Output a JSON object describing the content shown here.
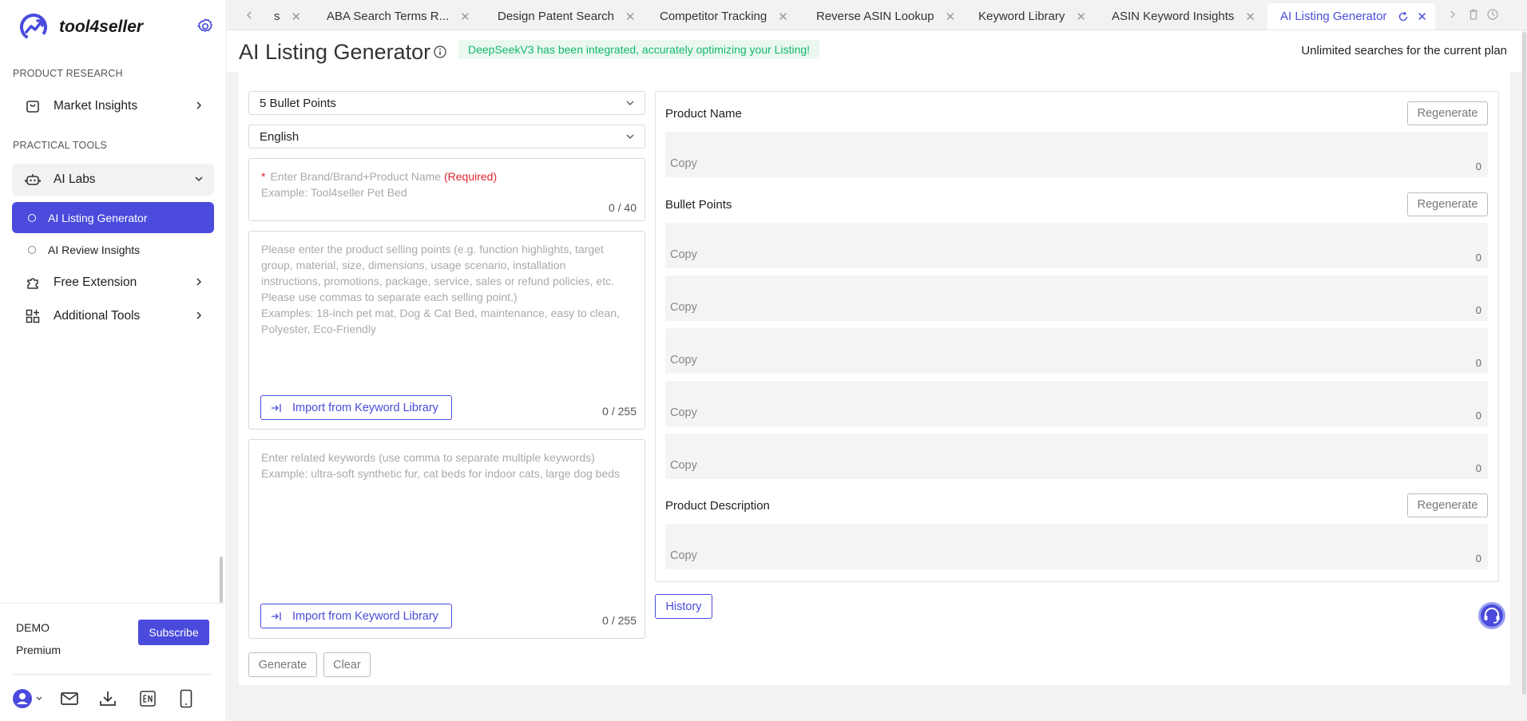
{
  "brand": {
    "name": "tool4seller"
  },
  "sidebar": {
    "section_product_research": "PRODUCT RESEARCH",
    "market_insights": "Market Insights",
    "section_practical_tools": "PRACTICAL TOOLS",
    "ai_labs": "AI Labs",
    "ai_listing_generator": "AI Listing Generator",
    "ai_review_insights": "AI Review Insights",
    "free_extension": "Free Extension",
    "additional_tools": "Additional Tools"
  },
  "user": {
    "name": "DEMO",
    "plan": "Premium",
    "subscribe_label": "Subscribe"
  },
  "tabs": [
    {
      "label": "s"
    },
    {
      "label": "ABA Search Terms R..."
    },
    {
      "label": "Design Patent Search"
    },
    {
      "label": "Competitor Tracking"
    },
    {
      "label": "Reverse ASIN Lookup"
    },
    {
      "label": "Keyword Library"
    },
    {
      "label": "ASIN Keyword Insights"
    },
    {
      "label": "AI Listing Generator"
    }
  ],
  "page": {
    "title": "AI Listing Generator",
    "notice": "DeepSeekV3 has been integrated, accurately optimizing your Listing!",
    "quota": "Unlimited searches for the current plan"
  },
  "form": {
    "bullet_select": "5 Bullet Points",
    "language_select": "English",
    "brand_placeholder": "Enter Brand/Brand+Product Name",
    "brand_required": "(Required)",
    "brand_example": "Example: Tool4seller Pet Bed",
    "brand_counter": "0 / 40",
    "selling_points_placeholder": "Please enter the product selling points (e.g. function highlights, target group, material, size, dimensions, usage scenario, installation instructions, promotions, package, service, sales or refund policies, etc. Please use commas to separate each selling point.)",
    "selling_points_example": "Examples: 18-inch pet mat, Dog & Cat Bed, maintenance, easy to clean, Polyester, Eco-Friendly",
    "selling_points_counter": "0 / 255",
    "keywords_placeholder": "Enter related keywords (use comma to separate multiple keywords)",
    "keywords_example": "Example: ultra-soft synthetic fur, cat beds for indoor cats, large dog beds",
    "keywords_counter": "0 / 255",
    "import_label": "Import from Keyword Library",
    "generate_label": "Generate",
    "clear_label": "Clear"
  },
  "results": {
    "product_name_label": "Product Name",
    "bullet_points_label": "Bullet Points",
    "product_description_label": "Product Description",
    "regenerate_label": "Regenerate",
    "copy_label": "Copy",
    "count": "0",
    "history_label": "History"
  },
  "icons": {
    "logo": "trend-chart-logo-icon",
    "gear": "gear-icon",
    "market": "shopping-bag-icon",
    "ai_labs": "robot-icon",
    "extension": "puzzle-icon",
    "tools": "grid-plus-icon",
    "support": "headset-icon"
  },
  "colors": {
    "accent": "#4a4bdc",
    "notice_green": "#14b86e",
    "required_red": "#e0242f"
  }
}
